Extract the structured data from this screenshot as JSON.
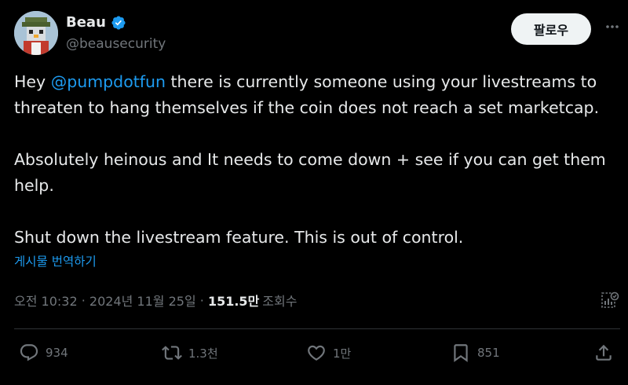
{
  "author": {
    "name": "Beau",
    "handle": "@beausecurity",
    "avatar_icon": "pixel-penguin-avatar",
    "verified_icon": "verified-badge-icon",
    "verified_color": "#1d9bf0"
  },
  "follow_label": "팔로우",
  "more_icon": "more-icon",
  "tweet": {
    "p1_pre": "Hey ",
    "p1_mention": "@pumpdotfun",
    "p1_post": " there is currently someone using your livestreams to threaten to hang themselves if the coin does not reach a set marketcap.",
    "p2": "Absolutely heinous and It needs to come down + see if you can get them help.",
    "p3": "Shut down the livestream feature. This is out of control."
  },
  "translate_label": "게시물 번역하기",
  "meta": {
    "time": "오전 10:32",
    "sep1": " · ",
    "date": "2024년 11월 25일",
    "sep2": " · ",
    "views_count": "151.5만",
    "views_label": "조회수"
  },
  "actions": {
    "reply_count": "934",
    "repost_count": "1.3천",
    "like_count": "1만",
    "bookmark_count": "851"
  },
  "colors": {
    "background": "#000000",
    "text": "#e7e9ea",
    "muted": "#71767b",
    "link": "#1d9bf0",
    "divider": "#2f3336"
  }
}
